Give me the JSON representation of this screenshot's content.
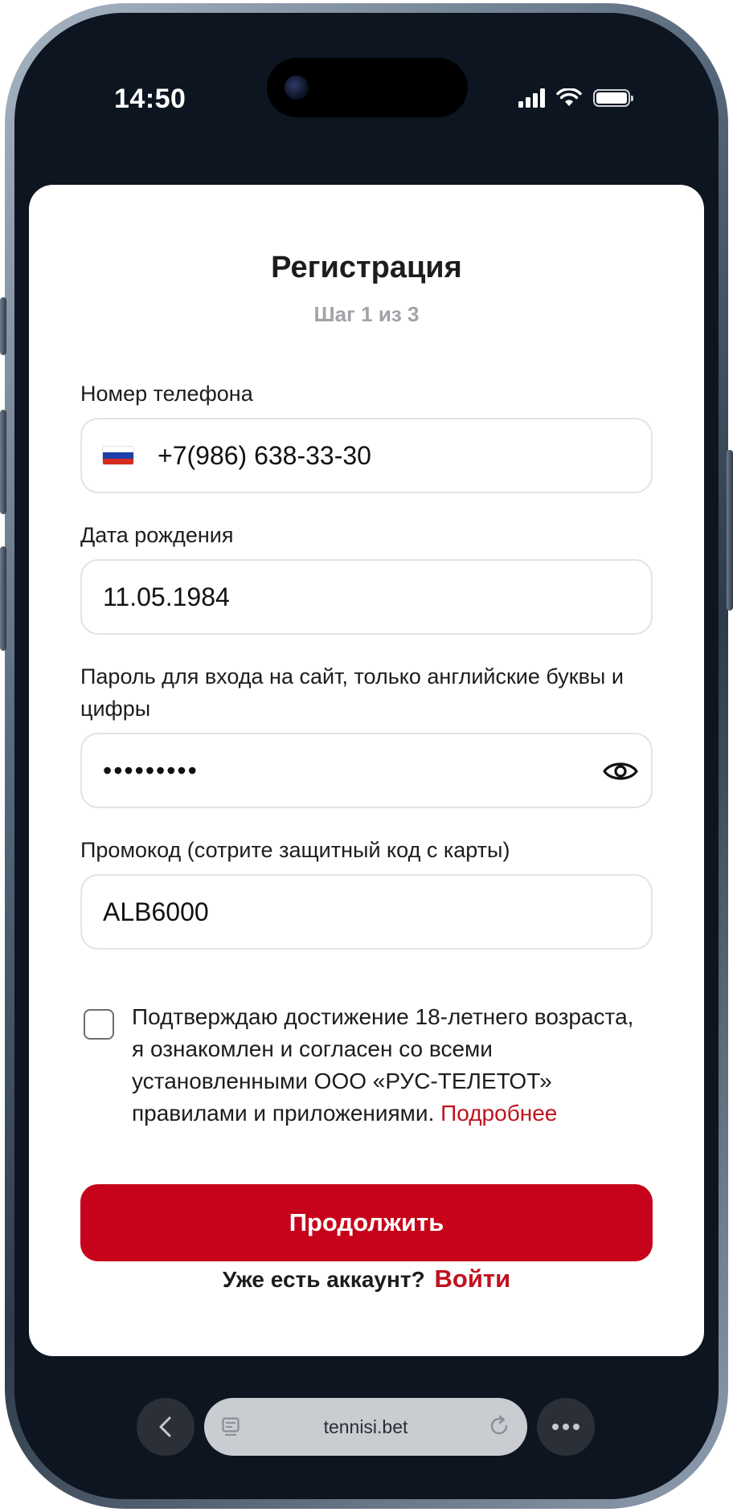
{
  "status_bar": {
    "time": "14:50"
  },
  "form": {
    "title": "Регистрация",
    "step": "Шаг 1 из 3",
    "phone": {
      "label": "Номер телефона",
      "value": "+7(986) 638-33-30",
      "flag_icon": "russia-flag-icon"
    },
    "birthdate": {
      "label": "Дата рождения",
      "value": "11.05.1984"
    },
    "password": {
      "label": "Пароль для входа на сайт, только английские буквы и цифры",
      "value": "•••••••••",
      "toggle_icon": "eye-icon"
    },
    "promo": {
      "label": "Промокод (сотрите защитный код с карты)",
      "value": "ALB6000"
    },
    "consent": {
      "checked": false,
      "text": "Подтверждаю достижение 18-летнего возраста, я ознакомлен и согласен со всеми установленными ООО «РУС-ТЕЛЕТОТ» правилами и приложениями.",
      "link": "Подробнее"
    },
    "continue_label": "Продолжить",
    "login_prompt": "Уже есть аккаунт?",
    "login_link": "Войти"
  },
  "browser": {
    "url": "tennisi.bet",
    "back_icon": "chevron-left-icon",
    "tabs_icon": "tab-overview-icon",
    "reload_icon": "reload-icon",
    "more_icon": "more-dots-icon"
  },
  "colors": {
    "accent": "#c6031b",
    "link": "#c1121f",
    "screen_bg": "#0d1521",
    "muted": "#a2a2a7"
  }
}
